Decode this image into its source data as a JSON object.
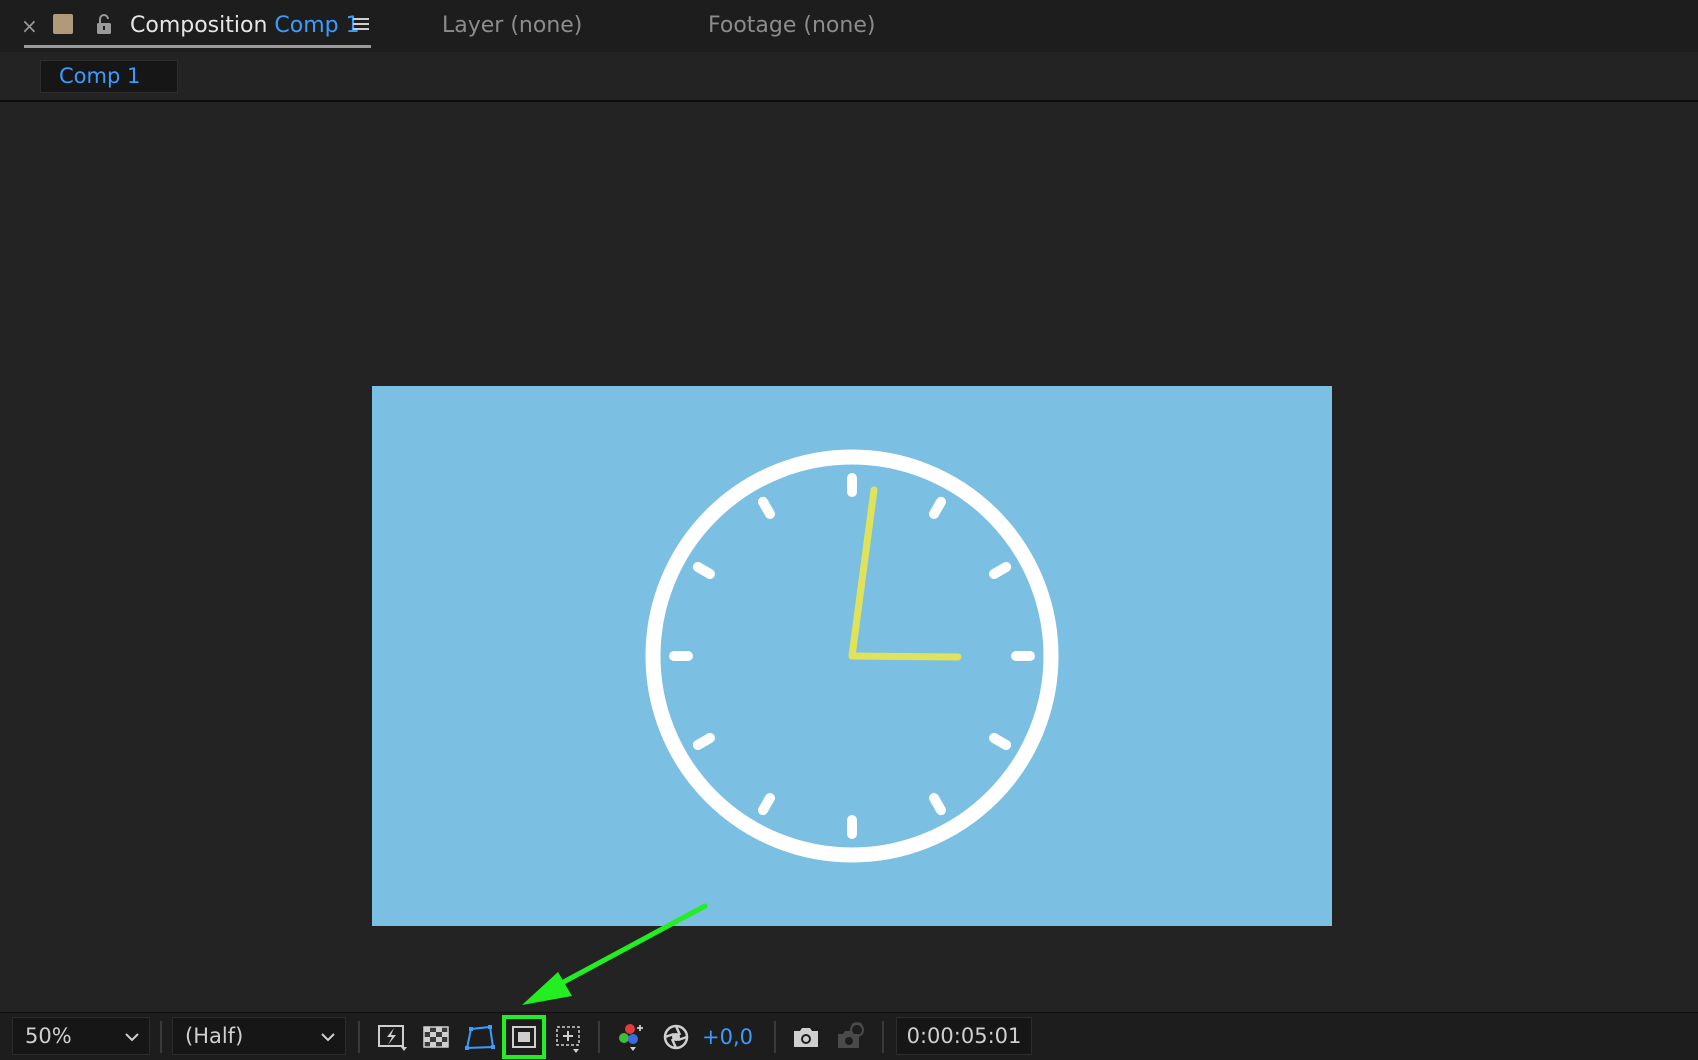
{
  "tabs": {
    "active": {
      "prefix": "Composition",
      "comp_name": "Comp 1"
    },
    "layer": "Layer (none)",
    "footage": "Footage (none)"
  },
  "breadcrumb": {
    "label": "Comp 1"
  },
  "composition": {
    "background_color": "#7bbfe3",
    "clock_face_color": "#ffffff",
    "hands_color": "#e0e35a"
  },
  "toolbar": {
    "zoom": "50%",
    "resolution": "(Half)",
    "exposure": "+0,0",
    "timecode": "0:00:05:01",
    "icons": [
      "fast-previews-icon",
      "transparency-grid-icon",
      "mask-visibility-icon",
      "region-of-interest-icon",
      "grid-guides-icon",
      "color-channel-icon",
      "exposure-reset-icon",
      "snapshot-icon",
      "show-snapshot-icon"
    ],
    "highlighted": "region-of-interest-icon",
    "highlight_color": "#22ee22"
  },
  "annotation": {
    "type": "arrow",
    "color": "#22ee22",
    "target": "region-of-interest-icon"
  }
}
